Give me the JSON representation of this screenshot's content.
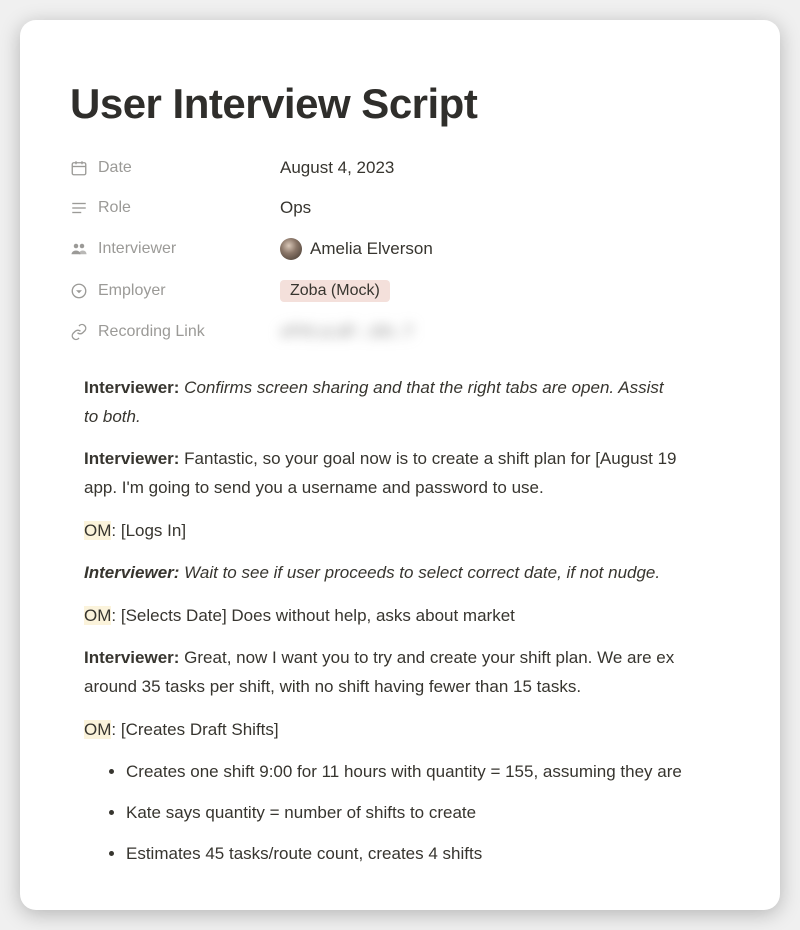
{
  "title": "User Interview Script",
  "props": {
    "date_label": "Date",
    "date_value": "August 4, 2023",
    "role_label": "Role",
    "role_value": "Ops",
    "interviewer_label": "Interviewer",
    "interviewer_value": "Amelia Elverson",
    "employer_label": "Employer",
    "employer_value": "Zoba (Mock)",
    "recording_label": "Recording Link",
    "recording_value": "xPhf.ul.dF:..t0h..T"
  },
  "speakers": {
    "interviewer": "Interviewer:",
    "om": "OM"
  },
  "lines": {
    "l1_text": "Confirms screen sharing and that the right tabs are open. Assist",
    "l1b": "to both.",
    "l2": "Fantastic, so your goal now is to create a shift plan for [August 19",
    "l2b": "app. I'm going to send you a username and password to use.",
    "l3_colon": ":",
    "l3": " [Logs In]",
    "l4": "Wait to see if user proceeds to select correct date, if not nudge.",
    "l5_colon": ":",
    "l5": " [Selects Date] Does without help, asks about market",
    "l6": "Great, now I want you to try and create your shift plan. We are ex",
    "l6b": "around 35 tasks per shift, with no shift having fewer than 15 tasks.",
    "l7_colon": ":",
    "l7": " [Creates Draft Shifts]"
  },
  "bullets": {
    "b1": "Creates one shift 9:00 for 11 hours with quantity = 155, assuming they are",
    "b2": "Kate says quantity = number of shifts to create",
    "b3": "Estimates 45 tasks/route count, creates 4 shifts"
  }
}
